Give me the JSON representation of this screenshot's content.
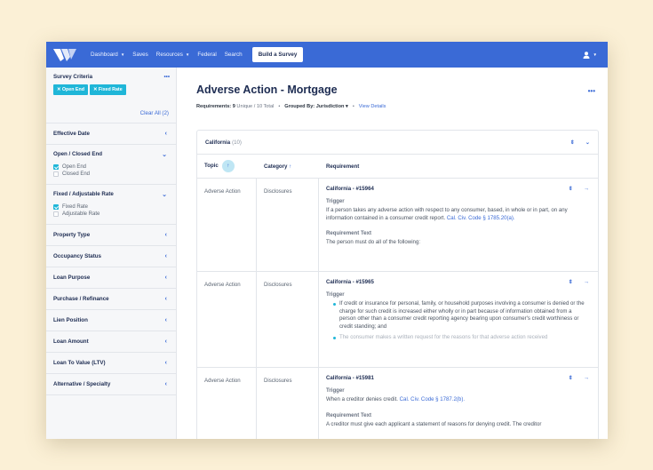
{
  "nav": {
    "items": [
      {
        "label": "Dashboard",
        "caret": true
      },
      {
        "label": "Saves",
        "caret": false
      },
      {
        "label": "Resources",
        "caret": true
      },
      {
        "label": "Federal",
        "caret": false
      },
      {
        "label": "Search",
        "caret": false
      }
    ],
    "build_label": "Build a Survey"
  },
  "sidebar": {
    "criteria_title": "Survey Criteria",
    "chips": [
      "Open End",
      "Fixed Rate"
    ],
    "clear_all": "Clear All (2)",
    "sections": [
      {
        "label": "Effective Date",
        "open": false
      },
      {
        "label": "Open / Closed End",
        "open": true,
        "options": [
          {
            "label": "Open End",
            "checked": true
          },
          {
            "label": "Closed End",
            "checked": false
          }
        ]
      },
      {
        "label": "Fixed / Adjustable Rate",
        "open": true,
        "options": [
          {
            "label": "Fixed Rate",
            "checked": true
          },
          {
            "label": "Adjustable Rate",
            "checked": false
          }
        ]
      },
      {
        "label": "Property Type",
        "open": false
      },
      {
        "label": "Occupancy Status",
        "open": false
      },
      {
        "label": "Loan Purpose",
        "open": false
      },
      {
        "label": "Purchase / Refinance",
        "open": false
      },
      {
        "label": "Lien Position",
        "open": false
      },
      {
        "label": "Loan Amount",
        "open": false
      },
      {
        "label": "Loan To Value (LTV)",
        "open": false
      },
      {
        "label": "Alternative / Specialty",
        "open": false
      }
    ]
  },
  "main": {
    "title": "Adverse Action - Mortgage",
    "req_label": "Requirements:",
    "unique_count": "9",
    "unique_label": "Unique",
    "total_label": "/ 10 Total",
    "grouped_label": "Grouped By:",
    "grouped_value": "Jurisdiction",
    "view_details": "View Details",
    "group_name": "California",
    "group_count": "(10)",
    "columns": {
      "topic": "Topic",
      "category": "Category",
      "requirement": "Requirement"
    },
    "rows": [
      {
        "topic": "Adverse Action",
        "category": "Disclosures",
        "title": "California - #15964",
        "trigger_label": "Trigger",
        "trigger_text": "If a person takes any adverse action with respect to any consumer, based, in whole or in part, on any information contained in a consumer credit report.",
        "trigger_link": "Cal. Civ. Code § 1785.20(a).",
        "req_label": "Requirement Text",
        "req_text": "The person must do all of the following:"
      },
      {
        "topic": "Adverse Action",
        "category": "Disclosures",
        "title": "California - #15965",
        "trigger_label": "Trigger",
        "bullet1": "If credit or insurance for personal, family, or household purposes involving a consumer is denied or the charge for such credit is increased either wholly or in part because of information obtained from a person other than a consumer credit reporting agency bearing upon consumer's credit worthiness or credit standing; and",
        "bullet2": "The consumer makes a written request for the reasons for that adverse action received"
      },
      {
        "topic": "Adverse Action",
        "category": "Disclosures",
        "title": "California - #15981",
        "trigger_label": "Trigger",
        "trigger_text": "When a creditor denies credit.",
        "trigger_link": "Cal. Civ. Code § 1787.2(b).",
        "req_label": "Requirement Text",
        "req_text": "A creditor must give each applicant a statement of reasons for denying credit. The creditor"
      }
    ]
  }
}
